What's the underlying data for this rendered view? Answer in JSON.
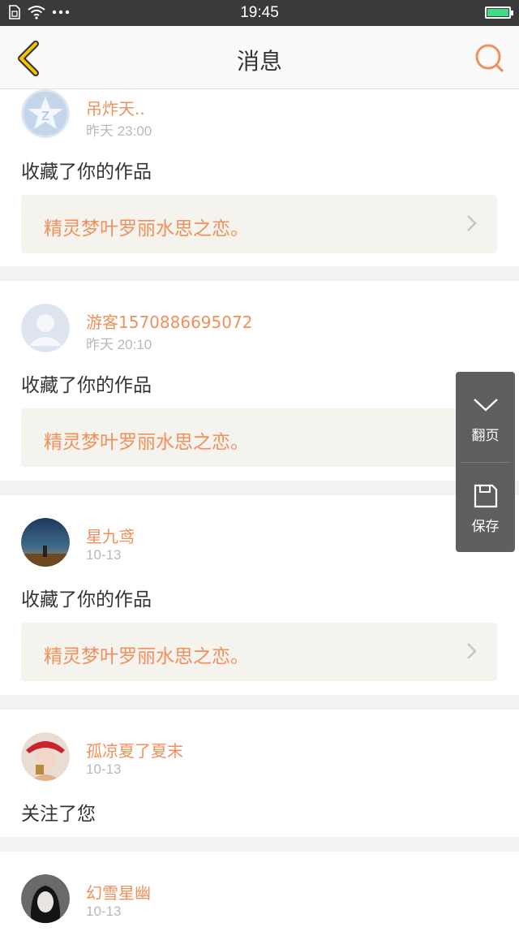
{
  "status_bar": {
    "time": "19:45",
    "icons": [
      "sim-icon",
      "wifi-icon",
      "more-dots-icon",
      "battery-charging-icon"
    ]
  },
  "header": {
    "title": "消息",
    "back_icon": "back-chevron-icon",
    "search_icon": "search-icon"
  },
  "colors": {
    "accent": "#f0905c",
    "back_icon": "#f5c400",
    "timestamp": "#b9b9b9",
    "card_link_bg": "#f4f3ee"
  },
  "messages": [
    {
      "user": "吊炸天..",
      "time": "昨天 23:00",
      "action": "收藏了你的作品",
      "work": "精灵梦叶罗丽水思之恋。",
      "avatar": "qq-default-avatar"
    },
    {
      "user": "游客1570886695072",
      "time": "昨天 20:10",
      "action": "收藏了你的作品",
      "work": "精灵梦叶罗丽水思之恋。",
      "avatar": "default-person-avatar"
    },
    {
      "user": "星九鸢",
      "time": "10-13",
      "action": "收藏了你的作品",
      "work": "精灵梦叶罗丽水思之恋。",
      "avatar": "photo-avatar"
    },
    {
      "user": "孤凉夏了夏末",
      "time": "10-13",
      "action": "关注了您",
      "avatar": "photo-avatar"
    },
    {
      "user": "幻雪星幽",
      "time": "10-13",
      "avatar": "photo-avatar"
    }
  ],
  "float_panel": {
    "page_turn_label": "翻页",
    "save_label": "保存"
  }
}
